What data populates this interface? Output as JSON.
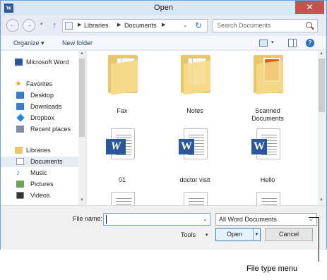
{
  "window": {
    "title": "Open",
    "app_icon_letter": "W",
    "close_glyph": "✕"
  },
  "navbar": {
    "back_glyph": "←",
    "forward_glyph": "→",
    "history_glyph": "▾",
    "up_glyph": "↑",
    "breadcrumbs": [
      "Libraries",
      "Documents"
    ],
    "separator_glyph": "▶",
    "dropdown_glyph": "⌄",
    "refresh_glyph": "↻",
    "search_placeholder": "Search Documents"
  },
  "toolbar": {
    "organize_label": "Organize ▾",
    "new_folder_label": "New folder",
    "view_dropdown_glyph": "▾",
    "help_glyph": "?"
  },
  "sidebar": {
    "items": [
      {
        "label": "Microsoft Word",
        "icon": "word-icon",
        "level": "top"
      },
      {
        "label": "Favorites",
        "icon": "star-icon",
        "level": "top"
      },
      {
        "label": "Desktop",
        "icon": "desktop-icon",
        "level": "child"
      },
      {
        "label": "Downloads",
        "icon": "downloads-icon",
        "level": "child"
      },
      {
        "label": "Dropbox",
        "icon": "dropbox-icon",
        "level": "child"
      },
      {
        "label": "Recent places",
        "icon": "recent-places-icon",
        "level": "child"
      },
      {
        "label": "Libraries",
        "icon": "libraries-icon",
        "level": "top"
      },
      {
        "label": "Documents",
        "icon": "documents-icon",
        "level": "child",
        "selected": true
      },
      {
        "label": "Music",
        "icon": "music-icon",
        "level": "child"
      },
      {
        "label": "Pictures",
        "icon": "pictures-icon",
        "level": "child"
      },
      {
        "label": "Videos",
        "icon": "videos-icon",
        "level": "child"
      }
    ]
  },
  "files": [
    {
      "name": "Fax",
      "type": "folder"
    },
    {
      "name": "Notes",
      "type": "folder"
    },
    {
      "name": "Scanned Documents",
      "type": "folder-photo"
    },
    {
      "name": "01",
      "type": "word-doc-2003"
    },
    {
      "name": "doctor visit",
      "type": "word-doc"
    },
    {
      "name": "Hello",
      "type": "word-doc"
    },
    {
      "name": "",
      "type": "doc"
    },
    {
      "name": "",
      "type": "doc"
    },
    {
      "name": "",
      "type": "doc"
    }
  ],
  "bottom": {
    "file_name_label": "File name:",
    "file_name_value": "",
    "file_type_value": "All Word Documents",
    "dropdown_glyph": "⌄",
    "tools_label": "Tools",
    "tools_dropdown_glyph": "▾",
    "open_label": "Open",
    "open_split_glyph": "▾",
    "cancel_label": "Cancel"
  },
  "annotation": {
    "callout_text": "File type menu"
  },
  "colors": {
    "accent": "#2b579a",
    "close": "#c75050",
    "folder": "#e9c66a",
    "title_bar": "#d8e6f6"
  }
}
